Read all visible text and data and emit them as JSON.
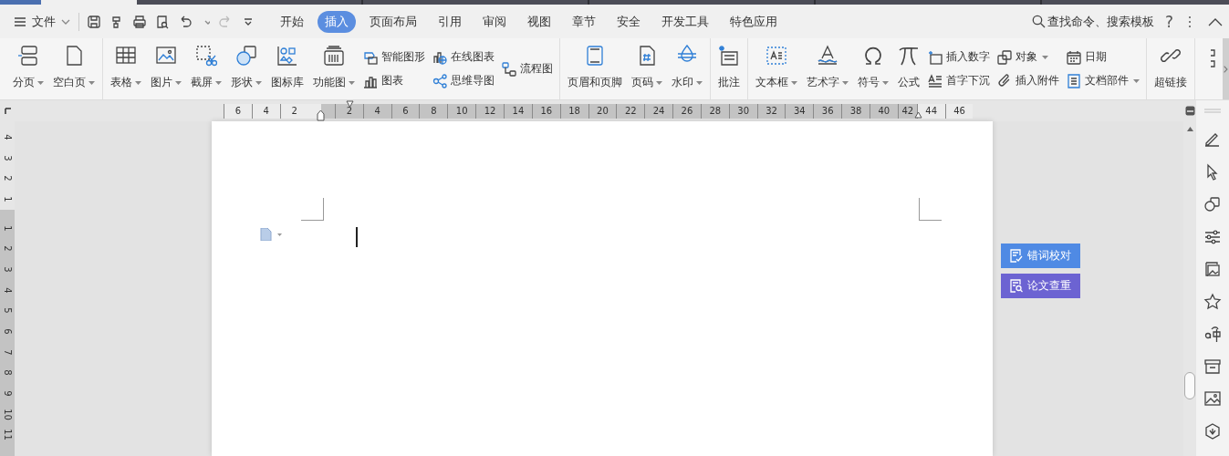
{
  "menu_bar": {
    "file_menu": "文件",
    "tabs": [
      {
        "label": "开始",
        "selected": false
      },
      {
        "label": "插入",
        "selected": true
      },
      {
        "label": "页面布局",
        "selected": false
      },
      {
        "label": "引用",
        "selected": false
      },
      {
        "label": "审阅",
        "selected": false
      },
      {
        "label": "视图",
        "selected": false
      },
      {
        "label": "章节",
        "selected": false
      },
      {
        "label": "安全",
        "selected": false
      },
      {
        "label": "开发工具",
        "selected": false
      },
      {
        "label": "特色应用",
        "selected": false
      }
    ],
    "search": "查找命令、搜索模板",
    "help": "?"
  },
  "ribbon": {
    "groups": [
      {
        "items": [
          {
            "kind": "large",
            "label": "分页",
            "dropdown": true
          },
          {
            "kind": "large",
            "label": "空白页",
            "dropdown": true
          }
        ]
      },
      {
        "items": [
          {
            "kind": "large",
            "label": "表格",
            "dropdown": true
          },
          {
            "kind": "large",
            "label": "图片",
            "dropdown": true
          },
          {
            "kind": "large",
            "label": "截屏",
            "dropdown": true
          },
          {
            "kind": "large",
            "label": "形状",
            "dropdown": true
          },
          {
            "kind": "large",
            "label": "图标库",
            "dropdown": false
          },
          {
            "kind": "large",
            "label": "功能图",
            "dropdown": true
          },
          {
            "kind": "stack",
            "items": [
              {
                "label": "智能图形",
                "dropdown": false
              },
              {
                "label": "图表",
                "dropdown": false
              }
            ]
          },
          {
            "kind": "stack",
            "items": [
              {
                "label": "在线图表",
                "dropdown": false
              },
              {
                "label": "思维导图",
                "dropdown": false
              }
            ]
          },
          {
            "kind": "stack",
            "items": [
              {
                "label": "流程图",
                "dropdown": false
              }
            ]
          }
        ]
      },
      {
        "items": [
          {
            "kind": "large",
            "label": "页眉和页脚",
            "dropdown": false
          },
          {
            "kind": "large",
            "label": "页码",
            "dropdown": true
          },
          {
            "kind": "large",
            "label": "水印",
            "dropdown": true
          }
        ]
      },
      {
        "items": [
          {
            "kind": "large",
            "label": "批注",
            "dropdown": false
          }
        ]
      },
      {
        "items": [
          {
            "kind": "large",
            "label": "文本框",
            "dropdown": true
          },
          {
            "kind": "large",
            "label": "艺术字",
            "dropdown": true
          },
          {
            "kind": "large",
            "label": "符号",
            "dropdown": true
          },
          {
            "kind": "large",
            "label": "公式",
            "dropdown": false
          },
          {
            "kind": "stack",
            "items": [
              {
                "label": "插入数字",
                "dropdown": false
              },
              {
                "label": "首字下沉",
                "dropdown": false
              }
            ]
          },
          {
            "kind": "stack",
            "items": [
              {
                "label": "对象",
                "dropdown": true
              },
              {
                "label": "插入附件",
                "dropdown": false
              }
            ]
          },
          {
            "kind": "stack",
            "items": [
              {
                "label": "日期",
                "dropdown": false
              },
              {
                "label": "文档部件",
                "dropdown": true
              }
            ]
          }
        ]
      },
      {
        "items": [
          {
            "kind": "large",
            "label": "超链接",
            "dropdown": false
          }
        ]
      }
    ]
  },
  "horizontal_ruler": {
    "left_numbers": [
      "6",
      "4",
      "2"
    ],
    "numbers": [
      "2",
      "4",
      "6",
      "8",
      "10",
      "12",
      "14",
      "16",
      "18",
      "20",
      "22",
      "24",
      "26",
      "28",
      "30",
      "32",
      "34",
      "36",
      "38",
      "40",
      "42"
    ],
    "right_numbers": [
      "44",
      "46"
    ]
  },
  "vertical_ruler": {
    "top_numbers": [
      "4",
      "3",
      "2",
      "1"
    ],
    "numbers": [
      "1",
      "2",
      "3",
      "4",
      "5",
      "6",
      "7",
      "8",
      "9",
      "10",
      "11"
    ]
  },
  "side_buttons": [
    {
      "label": "错词校对",
      "color": "#4f8ae4"
    },
    {
      "label": "论文查重",
      "color": "#6c63d2"
    }
  ]
}
